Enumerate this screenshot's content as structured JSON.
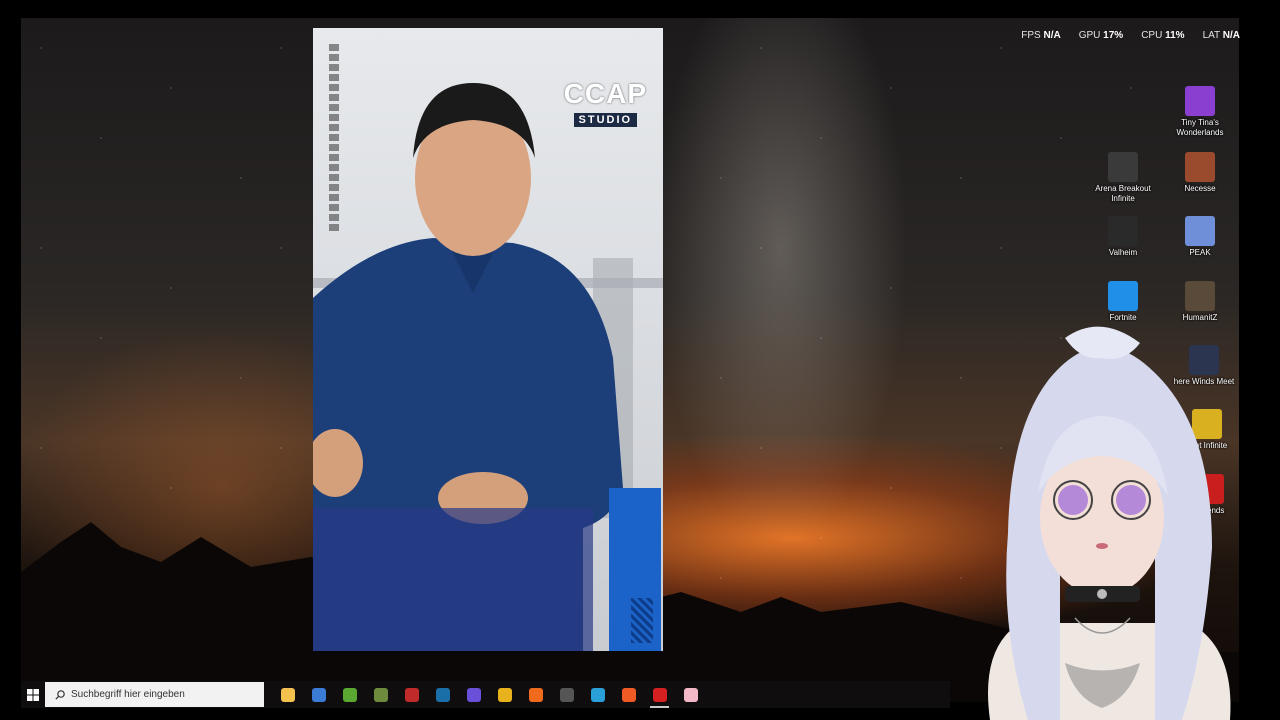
{
  "overlay_stats": [
    {
      "label": "FPS",
      "value": "N/A"
    },
    {
      "label": "GPU",
      "value": "17%"
    },
    {
      "label": "CPU",
      "value": "11%"
    },
    {
      "label": "LAT",
      "value": "N/A"
    }
  ],
  "video": {
    "logo_top": "CCAP",
    "logo_bottom": "STUDIO"
  },
  "desktop_icons": [
    {
      "label": "Tiny Tina's Wonderlands",
      "icon": "tiny-tinas-wonderlands-icon",
      "color": "#8a3fd0"
    },
    {
      "label": "Arena Breakout Infinite",
      "icon": "arena-breakout-infinite-icon",
      "color": "#3a3a3a"
    },
    {
      "label": "Necesse",
      "icon": "necesse-icon",
      "color": "#9a4b2e"
    },
    {
      "label": "Valheim",
      "icon": "valheim-icon",
      "color": "#2a2a2a"
    },
    {
      "label": "PEAK",
      "icon": "peak-icon",
      "color": "#6f8fd8"
    },
    {
      "label": "Fortnite",
      "icon": "fortnite-icon",
      "color": "#1f8fe8"
    },
    {
      "label": "HumanitZ",
      "icon": "humanitz-icon",
      "color": "#5a4a3a"
    },
    {
      "label": "here Winds Meet",
      "icon": "where-winds-meet-icon",
      "color": "#2c3550"
    },
    {
      "label": "light Infinite",
      "icon": "deadlight-infinite-icon",
      "color": "#d8b020"
    },
    {
      "label": "Legends",
      "icon": "apex-legends-icon",
      "color": "#c81e1e"
    }
  ],
  "taskbar": {
    "search_placeholder": "Suchbegriff hier eingeben",
    "apps": [
      {
        "name": "file-explorer-icon",
        "color": "#f2c14e",
        "active": false
      },
      {
        "name": "microsoft-store-icon",
        "color": "#3a7bd5",
        "active": false
      },
      {
        "name": "xbox-app-icon",
        "color": "#5aa832",
        "active": false
      },
      {
        "name": "minecraft-launcher-icon",
        "color": "#6e8a3c",
        "active": false
      },
      {
        "name": "game-launcher-icon",
        "color": "#c02a2a",
        "active": false
      },
      {
        "name": "steam-icon",
        "color": "#1b6fa8",
        "active": false
      },
      {
        "name": "discord-icon",
        "color": "#6a4fd8",
        "active": false
      },
      {
        "name": "chrome-icon",
        "color": "#e8b21c",
        "active": false
      },
      {
        "name": "firefox-icon",
        "color": "#f06a1c",
        "active": false
      },
      {
        "name": "obs-icon",
        "color": "#555555",
        "active": false
      },
      {
        "name": "app-launcher-icon",
        "color": "#2aa0d8",
        "active": false
      },
      {
        "name": "brave-icon",
        "color": "#f05a24",
        "active": false
      },
      {
        "name": "opera-icon",
        "color": "#d42020",
        "active": true
      },
      {
        "name": "vtube-studio-icon",
        "color": "#f3b8c8",
        "active": false
      }
    ]
  }
}
